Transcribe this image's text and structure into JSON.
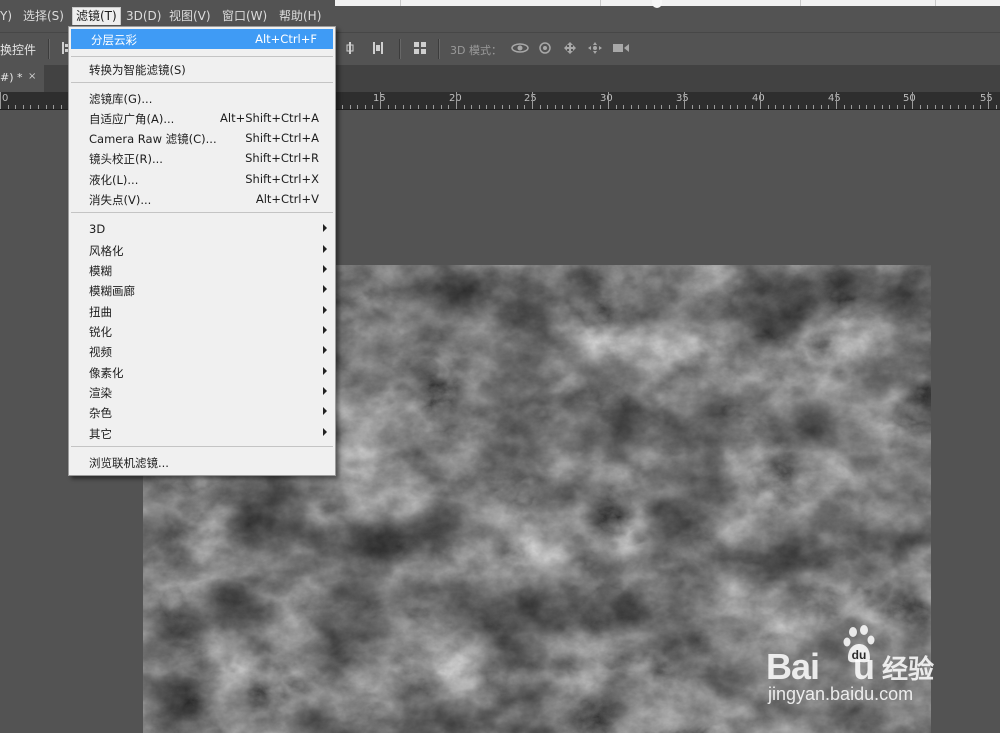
{
  "menubar": {
    "items": [
      {
        "label": "Y)"
      },
      {
        "label": "选择(S)"
      },
      {
        "label": "滤镜(T)"
      },
      {
        "label": "3D(D)"
      },
      {
        "label": "视图(V)"
      },
      {
        "label": "窗口(W)"
      },
      {
        "label": "帮助(H)"
      }
    ]
  },
  "options_bar": {
    "transform_label": "换控件",
    "mode_label": "3D 模式："
  },
  "tab": {
    "title": "#) *",
    "close": "×"
  },
  "ruler": {
    "labels": [
      "0",
      "15",
      "20",
      "25",
      "30",
      "35",
      "40",
      "45",
      "50",
      "55"
    ]
  },
  "filter_menu": {
    "items": [
      {
        "label": "分层云彩",
        "shortcut": "Alt+Ctrl+F",
        "highlighted": true
      },
      {
        "label": "转换为智能滤镜(S)",
        "shortcut": ""
      },
      {
        "label": "滤镜库(G)...",
        "shortcut": ""
      },
      {
        "label": "自适应广角(A)...",
        "shortcut": "Alt+Shift+Ctrl+A"
      },
      {
        "label": "Camera Raw 滤镜(C)...",
        "shortcut": "Shift+Ctrl+A"
      },
      {
        "label": "镜头校正(R)...",
        "shortcut": "Shift+Ctrl+R"
      },
      {
        "label": "液化(L)...",
        "shortcut": "Shift+Ctrl+X"
      },
      {
        "label": "消失点(V)...",
        "shortcut": "Alt+Ctrl+V"
      },
      {
        "label": "3D",
        "submenu": true
      },
      {
        "label": "风格化",
        "submenu": true
      },
      {
        "label": "模糊",
        "submenu": true
      },
      {
        "label": "模糊画廊",
        "submenu": true
      },
      {
        "label": "扭曲",
        "submenu": true
      },
      {
        "label": "锐化",
        "submenu": true
      },
      {
        "label": "视频",
        "submenu": true
      },
      {
        "label": "像素化",
        "submenu": true
      },
      {
        "label": "渲染",
        "submenu": true
      },
      {
        "label": "杂色",
        "submenu": true
      },
      {
        "label": "其它",
        "submenu": true
      },
      {
        "label": "浏览联机滤镜...",
        "shortcut": ""
      }
    ]
  },
  "watermark": {
    "brand": "Bai",
    "brand2": "u",
    "cn": "经验",
    "url": "jingyan.baidu.com"
  },
  "colors": {
    "highlight": "#3f9bf5",
    "panel": "#535353",
    "menu_bg": "#f0f0f0"
  }
}
